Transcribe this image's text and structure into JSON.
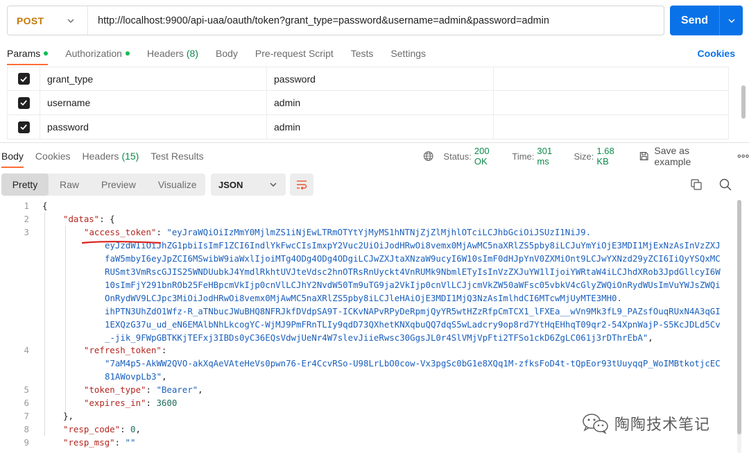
{
  "request": {
    "method": "POST",
    "url": "http://localhost:9900/api-uaa/oauth/token?grant_type=password&username=admin&password=admin",
    "send_label": "Send"
  },
  "request_tabs": {
    "params": "Params",
    "authorization": "Authorization",
    "headers": "Headers",
    "headers_count": "(8)",
    "body": "Body",
    "prerequest": "Pre-request Script",
    "tests": "Tests",
    "settings": "Settings",
    "cookies": "Cookies"
  },
  "params": [
    {
      "key": "grant_type",
      "value": "password",
      "checked": true
    },
    {
      "key": "username",
      "value": "admin",
      "checked": true
    },
    {
      "key": "password",
      "value": "admin",
      "checked": true
    }
  ],
  "response_tabs": {
    "body": "Body",
    "cookies": "Cookies",
    "headers": "Headers",
    "headers_count": "(15)",
    "test_results": "Test Results"
  },
  "response_meta": {
    "status_label": "Status:",
    "status_value": "200 OK",
    "time_label": "Time:",
    "time_value": "301 ms",
    "size_label": "Size:",
    "size_value": "1.68 KB",
    "save_label": "Save as example",
    "more": "ooo"
  },
  "view_modes": {
    "pretty": "Pretty",
    "raw": "Raw",
    "preview": "Preview",
    "visualize": "Visualize",
    "format": "JSON"
  },
  "code": {
    "line_numbers": [
      "1",
      "2",
      "3",
      "4",
      "5",
      "6",
      "7",
      "8",
      "9"
    ],
    "open_brace": "{",
    "datas_key": "\"datas\"",
    "datas_tail": ": {",
    "access_key": "\"access_token\"",
    "colon_sp": ": ",
    "access_line1": "\"eyJraWQiOiIzMmY0MjlmZS1iNjEwLTRmOTYtYjMyMS1hNTNjZjZlMjhlOTciLCJhbGciOiJSUzI1NiJ9.",
    "access_line2": "eyJzdWIiOiJhZG1pbiIsImF1ZCI6IndlYkFwcCIsImxpY2Vuc2UiOiJodHRwOi8vemx0MjAwMC5naXRlZS5pby8iLCJuYmYiOjE3MDI1MjExNzAsInVzZXJ",
    "access_line3": "faW5mbyI6eyJpZCI6MSwibW9iaWxlIjoiMTg4ODg4ODg4ODgiLCJwZXJtaXNzaW9ucyI6W10sImF0dHJpYnV0ZXMiOnt9LCJwYXNzd29yZCI6IiQyYSQxMC",
    "access_line4": "RUSmt3VmRscGJIS25WNDUubkJ4YmdlRkhtUVJteVdsc2hnOTRsRnUyckt4VnRUMk9NbmlETyIsInVzZXJuYW1lIjoiYWRtaW4iLCJhdXRob3JpdGllcyI6W",
    "access_line5": "10sImFjY291bnROb25FeHBpcmVkIjp0cnVlLCJhY2NvdW50Tm9uTG9ja2VkIjp0cnVlLCJjcmVkZW50aWFsc05vbkV4cGlyZWQiOnRydWUsImVuYWJsZWQi",
    "access_line6": "OnRydWV9LCJpc3MiOiJodHRwOi8vemx0MjAwMC5naXRlZS5pby8iLCJleHAiOjE3MDI1MjQ3NzAsImlhdCI6MTcwMjUyMTE3MH0.",
    "access_line7": "ihPTN3UhZdO1Wfz-R_aTNbucJWuBHQ8NFRJkfDVdpSA9T-ICKvNAPvRPyDeRpmjQyYR5wtHZzRfpCmTCX1_lFXEa__wVn9Mk3fL9_PAZsfOuqRUxN4A3qGI",
    "access_line8": "1EXQzG37u_ud_eN6EMAlbNhLkcogYC-WjMJ9PmFRnTLIy9qdD73QXhetKNXqbuQQ7dqS5wLadcry9op8rd7YtHqEHhqT09qr2-54XpnWajP-S5KcJDLd5Cv",
    "access_line9": "_-jik_9FWpGBTKKjTEFxj3IBDs0yC36EQsVdwjUeNr4W7slevJiieRwsc30GgsJL0r4SlVMjVpFti2TFSo1ckD6ZgLC061j3rDThrEbA\"",
    "comma": ",",
    "refresh_key": "\"refresh_token\"",
    "refresh_tail": ":",
    "refresh_line1": "\"7aM4p5-AkWW2QVO-akXqAeVAteHeVs0pwn76-Er4CcvRSo-U98LrLbO0cow-Vx3pgSc0bG1e8XQq1M-zfksFoD4t-tQpEor93tUuyqqP_WoIMBtkotjcEC",
    "refresh_line2": "81AWovpLb3\"",
    "token_type_key": "\"token_type\"",
    "token_type_val": "\"Bearer\"",
    "expires_key": "\"expires_in\"",
    "expires_val": "3600",
    "close_inner": "},",
    "resp_code_key": "\"resp_code\"",
    "resp_code_val": "0",
    "resp_msg_key": "\"resp_msg\"",
    "resp_msg_val": "\"\""
  },
  "watermark": "陶陶技术笔记",
  "colors": {
    "accent": "#0a72e8",
    "method": "#c47a0a",
    "json_key": "#b3261e",
    "json_string": "#1a5fbd",
    "status_ok": "#0c8a4a",
    "tab_underline": "#ff6c37",
    "annotation": "#d9201b"
  },
  "icons": [
    "chevron-down-icon",
    "globe-icon",
    "save-icon",
    "wrap-icon",
    "copy-icon",
    "search-icon",
    "wechat-icon"
  ]
}
